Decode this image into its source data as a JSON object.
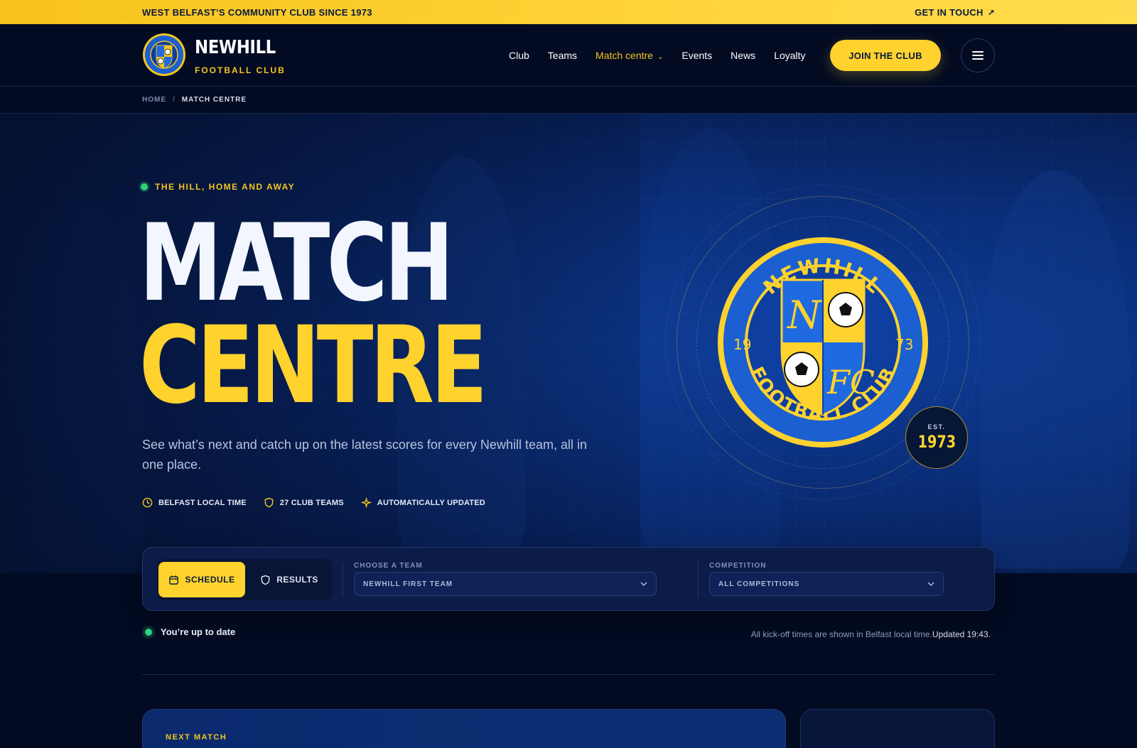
{
  "topbar": {
    "tagline": "WEST BELFAST’S COMMUNITY CLUB SINCE 1973",
    "contact": "GET IN TOUCH"
  },
  "brand": {
    "name": "NEWHILL",
    "subtitle": "FOOTBALL CLUB"
  },
  "nav": {
    "links": [
      "Club",
      "Teams",
      "Match centre",
      "Events",
      "News",
      "Loyalty"
    ],
    "active": "Match centre",
    "cta": "JOIN THE CLUB"
  },
  "breadcrumb": {
    "home": "HOME",
    "separator": "/",
    "current": "MATCH CENTRE"
  },
  "hero": {
    "eyebrow": "THE HILL, HOME AND AWAY",
    "title_line1": "MATCH",
    "title_line2": "CENTRE",
    "description": "See what’s next and catch up on the latest scores for every Newhill team, all in one place.",
    "chips": [
      "BELFAST LOCAL TIME",
      "27 CLUB TEAMS",
      "AUTOMATICALLY UPDATED"
    ],
    "crest": {
      "top_text": "NEWHILL",
      "bottom_text": "FOOTBALL CLUB",
      "year_left": "19",
      "year_right": "73",
      "letters_top": "N",
      "letters_bottom": "FC"
    },
    "est_label": "EST.",
    "est_year": "1973"
  },
  "filters": {
    "tabs": [
      "SCHEDULE",
      "RESULTS"
    ],
    "active_tab": "SCHEDULE",
    "team_label": "CHOOSE A TEAM",
    "team_value": "NEWHILL FIRST TEAM",
    "competition_label": "COMPETITION",
    "competition_value": "ALL COMPETITIONS"
  },
  "status": {
    "text": "You’re up to date",
    "note": "All kick-off times are shown in Belfast local time.",
    "updated": "Updated 19:43."
  },
  "cards": {
    "next_match_label": "NEXT MATCH"
  },
  "colors": {
    "accent": "#ffd22e",
    "navy": "#030b22",
    "royal": "#0a2f7c",
    "live_green": "#2fd27a"
  }
}
